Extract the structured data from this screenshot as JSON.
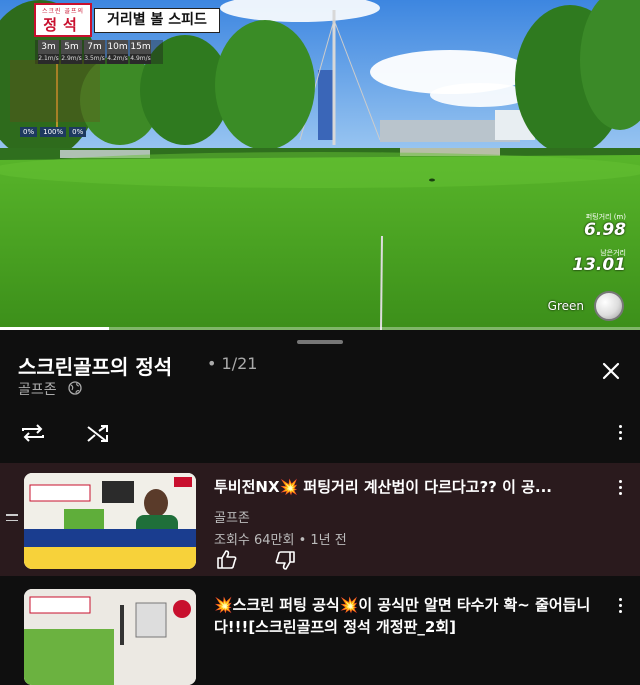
{
  "video": {
    "badge_sub": "스크린 골프의",
    "badge_main": "정석",
    "overlay_title": "거리별 볼 스피드",
    "distances": [
      {
        "m": "3m",
        "s": "2.1m/s"
      },
      {
        "m": "5m",
        "s": "2.9m/s"
      },
      {
        "m": "7m",
        "s": "3.5m/s"
      },
      {
        "m": "10m",
        "s": "4.2m/s"
      },
      {
        "m": "15m",
        "s": "4.9m/s"
      }
    ],
    "percents": [
      "0%",
      "100%",
      "0%"
    ],
    "hud": {
      "putt_distance_label": "퍼팅거리 (m)",
      "putt_distance_value": "6.98",
      "remain_label": "남은거리",
      "remain_value": "13.01",
      "surface": "Green"
    },
    "progress": 0.17
  },
  "playlist": {
    "title": "스크린골프의 정석",
    "position": "• 1/21",
    "channel": "골프존",
    "icons": [
      "globe-icon",
      "repeat-icon",
      "shuffle-icon",
      "more-vert-icon",
      "close-icon",
      "drag-handle-icon",
      "like-icon",
      "dislike-icon"
    ],
    "items": [
      {
        "title": "투비전NX💥 퍼팅거리 계산법이 다르다고?? 이 공...",
        "channel": "골프존",
        "meta": "조회수 64만회 • 1년 전",
        "thumb_caption1": "한백이 알려주는 TWOVISION NX",
        "thumb_caption2": "퍼팅 거리 계산법 공개"
      },
      {
        "title": "💥스크린 퍼팅 공식💥이 공식만 알면 타수가 확~ 줄어듭니다!!![스크린골프의 정석 개정판_2회]",
        "channel": "",
        "meta": ""
      }
    ]
  },
  "colors": {
    "accent_red": "#c8102e",
    "active_row": "#2a1a1d",
    "panel_bg": "#0f0f0f"
  }
}
